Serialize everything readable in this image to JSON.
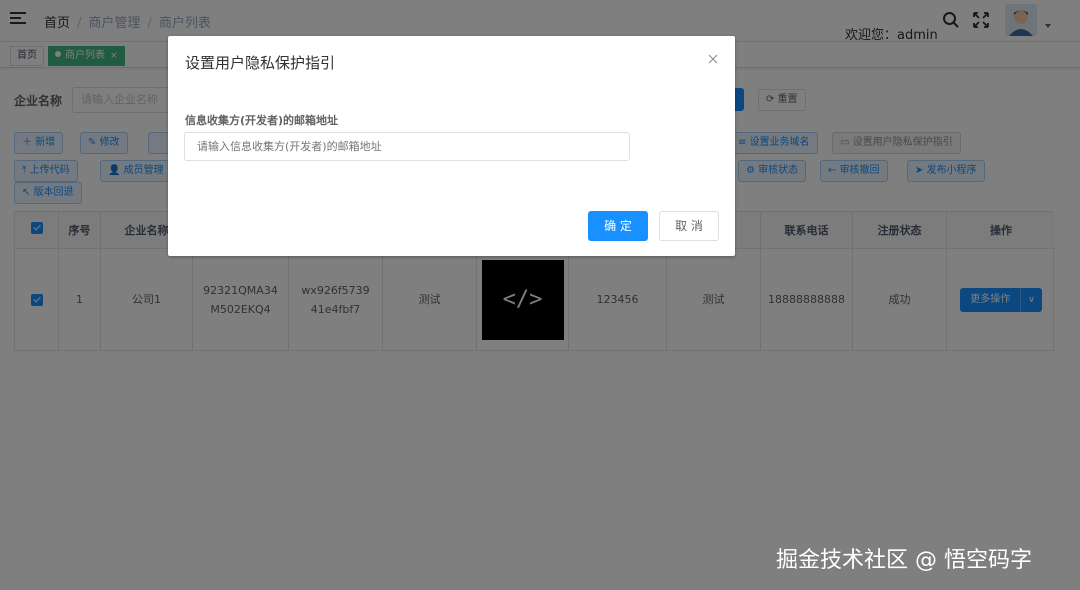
{
  "header": {
    "breadcrumb": [
      "首页",
      "商户管理",
      "商户列表"
    ],
    "breadcrumb_sep": "/",
    "welcome": "欢迎您：admin"
  },
  "tags": {
    "home": "首页",
    "active": "商户列表",
    "close_glyph": "×"
  },
  "search": {
    "label": "企业名称",
    "placeholder": "请输入企业名称",
    "reset_label": "重置"
  },
  "toolbar": {
    "row1": [
      "新增",
      "修改",
      "设置业务域名",
      "设置用户隐私保护指引"
    ],
    "row2": [
      "上传代码",
      "成员管理",
      "审核状态",
      "审核撤回",
      "发布小程序"
    ],
    "row3": [
      "版本回退"
    ]
  },
  "table": {
    "headers": [
      "序号",
      "企业名称",
      "联系电话",
      "注册状态",
      "操作"
    ],
    "row": {
      "index": "1",
      "company": "公司1",
      "code_a": "92321QMA34M502EKQ4",
      "code_b": "wx926f573941e4fbf7",
      "name": "测试",
      "thumb": "</>",
      "num": "123456",
      "contact": "测试",
      "phone": "18888888888",
      "status": "成功",
      "action": "更多操作",
      "action_arrow": "∨"
    }
  },
  "dialog": {
    "title": "设置用户隐私保护指引",
    "field_label": "信息收集方(开发者)的邮箱地址",
    "field_placeholder": "请输入信息收集方(开发者)的邮箱地址",
    "ok_label": "确 定",
    "cancel_label": "取 消"
  },
  "watermark": "掘金技术社区 @ 悟空码字",
  "colors": {
    "primary": "#1890ff",
    "tag_active": "#42b983",
    "overlay": "rgba(0,0,0,0.5)"
  }
}
